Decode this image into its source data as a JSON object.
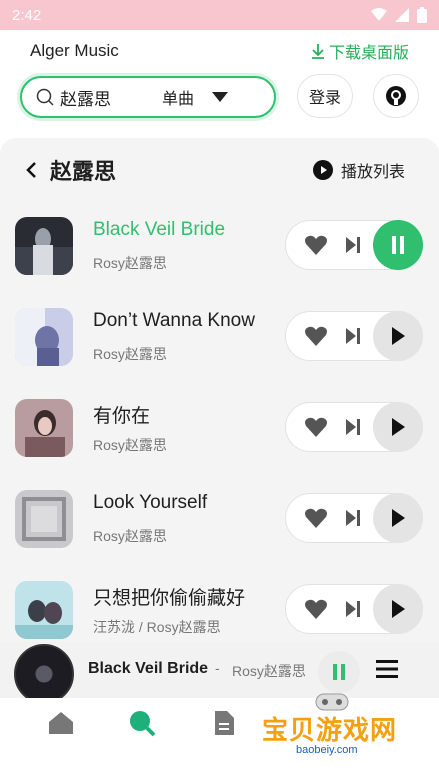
{
  "status": {
    "time": "2:42"
  },
  "app": {
    "title": "Alger Music",
    "download": "下载桌面版"
  },
  "search": {
    "value": "赵露思",
    "type": "单曲",
    "login": "登录"
  },
  "header": {
    "artist": "赵露思",
    "playlist": "播放列表"
  },
  "songs": [
    {
      "title": "Black Veil Bride",
      "artist": "Rosy赵露思",
      "playing": true
    },
    {
      "title": "Don’t Wanna Know",
      "artist": "Rosy赵露思",
      "playing": false
    },
    {
      "title": "有你在",
      "artist": "Rosy赵露思",
      "playing": false
    },
    {
      "title": "Look Yourself",
      "artist": "Rosy赵露思",
      "playing": false
    },
    {
      "title": "只想把你偷偷藏好",
      "artist": "汪苏泷 / Rosy赵露思",
      "playing": false
    }
  ],
  "player": {
    "title": "Black Veil Bride",
    "separator": "-",
    "artist": "Rosy赵露思"
  },
  "watermark": {
    "text": "宝贝游戏网",
    "site": "baobeiy.com"
  },
  "colors": {
    "accent": "#2fbf6e",
    "statusbar": "#f7c6cf"
  }
}
